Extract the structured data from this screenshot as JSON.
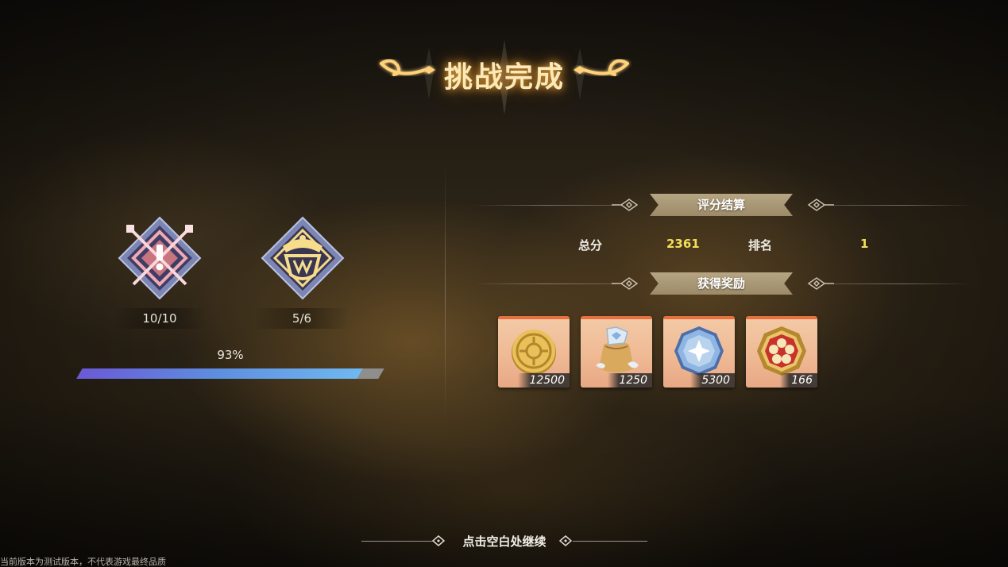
{
  "title": "挑战完成",
  "badges": [
    {
      "icon": "crossed-swords-exclamation-icon",
      "count": "10/10"
    },
    {
      "icon": "golden-crest-icon",
      "count": "5/6"
    }
  ],
  "progress": {
    "label": "93%",
    "value": 0.93
  },
  "score_section": {
    "header": "评分结算",
    "total_label": "总分",
    "total_value": "2361",
    "rank_label": "排名",
    "rank_value": "1"
  },
  "rewards_section": {
    "header": "获得奖励",
    "items": [
      {
        "icon": "gold-coin-icon",
        "qty": "12500"
      },
      {
        "icon": "material-pouch-icon",
        "qty": "1250"
      },
      {
        "icon": "blue-crystal-token-icon",
        "qty": "5300"
      },
      {
        "icon": "red-flower-medal-icon",
        "qty": "166"
      }
    ]
  },
  "continue_text": "点击空白处继续",
  "disclaimer": "当前版本为测试版本，不代表游戏最终品质",
  "colors": {
    "score_value": "#f3df5a",
    "progress_start": "#6a5ad6",
    "progress_end": "#6fb8f0",
    "reward_top": "#e6703e"
  }
}
